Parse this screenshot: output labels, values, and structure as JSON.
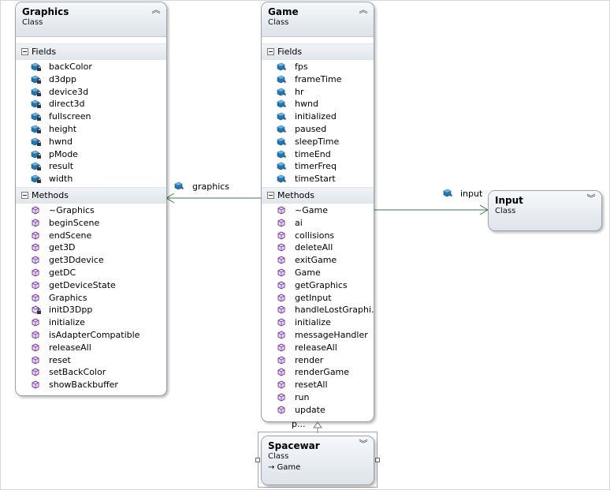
{
  "classes": {
    "graphics": {
      "name": "Graphics",
      "stereotype": "Class",
      "toggle": "︽",
      "fields_label": "Fields",
      "fields": [
        {
          "name": "backColor",
          "icon": "private-field-icon"
        },
        {
          "name": "d3dpp",
          "icon": "private-field-icon"
        },
        {
          "name": "device3d",
          "icon": "private-field-icon"
        },
        {
          "name": "direct3d",
          "icon": "private-field-icon"
        },
        {
          "name": "fullscreen",
          "icon": "private-field-icon"
        },
        {
          "name": "height",
          "icon": "private-field-icon"
        },
        {
          "name": "hwnd",
          "icon": "private-field-icon"
        },
        {
          "name": "pMode",
          "icon": "private-field-icon"
        },
        {
          "name": "result",
          "icon": "private-field-icon"
        },
        {
          "name": "width",
          "icon": "private-field-icon"
        }
      ],
      "methods_label": "Methods",
      "methods": [
        {
          "name": "~Graphics",
          "icon": "method-icon"
        },
        {
          "name": "beginScene",
          "icon": "method-icon"
        },
        {
          "name": "endScene",
          "icon": "method-icon"
        },
        {
          "name": "get3D",
          "icon": "method-icon"
        },
        {
          "name": "get3Ddevice",
          "icon": "method-icon"
        },
        {
          "name": "getDC",
          "icon": "method-icon"
        },
        {
          "name": "getDeviceState",
          "icon": "method-icon"
        },
        {
          "name": "Graphics",
          "icon": "method-icon"
        },
        {
          "name": "initD3Dpp",
          "icon": "private-method-icon"
        },
        {
          "name": "initialize",
          "icon": "method-icon"
        },
        {
          "name": "isAdapterCompatible",
          "icon": "method-icon"
        },
        {
          "name": "releaseAll",
          "icon": "method-icon"
        },
        {
          "name": "reset",
          "icon": "method-icon"
        },
        {
          "name": "setBackColor",
          "icon": "method-icon"
        },
        {
          "name": "showBackbuffer",
          "icon": "method-icon"
        }
      ]
    },
    "game": {
      "name": "Game",
      "stereotype": "Class",
      "toggle": "︽",
      "fields_label": "Fields",
      "fields": [
        {
          "name": "fps",
          "icon": "protected-field-icon"
        },
        {
          "name": "frameTime",
          "icon": "protected-field-icon"
        },
        {
          "name": "hr",
          "icon": "protected-field-icon"
        },
        {
          "name": "hwnd",
          "icon": "protected-field-icon"
        },
        {
          "name": "initialized",
          "icon": "protected-field-icon"
        },
        {
          "name": "paused",
          "icon": "protected-field-icon"
        },
        {
          "name": "sleepTime",
          "icon": "protected-field-icon"
        },
        {
          "name": "timeEnd",
          "icon": "protected-field-icon"
        },
        {
          "name": "timerFreq",
          "icon": "protected-field-icon"
        },
        {
          "name": "timeStart",
          "icon": "protected-field-icon"
        }
      ],
      "methods_label": "Methods",
      "methods": [
        {
          "name": "~Game",
          "icon": "method-icon"
        },
        {
          "name": "ai",
          "icon": "method-icon"
        },
        {
          "name": "collisions",
          "icon": "method-icon"
        },
        {
          "name": "deleteAll",
          "icon": "method-icon"
        },
        {
          "name": "exitGame",
          "icon": "method-icon"
        },
        {
          "name": "Game",
          "icon": "method-icon"
        },
        {
          "name": "getGraphics",
          "icon": "method-icon"
        },
        {
          "name": "getInput",
          "icon": "method-icon"
        },
        {
          "name": "handleLostGraphi...",
          "icon": "method-icon"
        },
        {
          "name": "initialize",
          "icon": "method-icon"
        },
        {
          "name": "messageHandler",
          "icon": "method-icon"
        },
        {
          "name": "releaseAll",
          "icon": "method-icon"
        },
        {
          "name": "render",
          "icon": "method-icon"
        },
        {
          "name": "renderGame",
          "icon": "method-icon"
        },
        {
          "name": "resetAll",
          "icon": "method-icon"
        },
        {
          "name": "run",
          "icon": "method-icon"
        },
        {
          "name": "update",
          "icon": "method-icon"
        }
      ]
    },
    "input": {
      "name": "Input",
      "stereotype": "Class",
      "toggle": "︾"
    },
    "spacewar": {
      "name": "Spacewar",
      "stereotype": "Class",
      "toggle": "︾",
      "inherits": "→ Game"
    }
  },
  "associations": {
    "graphics": {
      "label": "graphics",
      "icon": "protected-field-icon"
    },
    "input": {
      "label": "input",
      "icon": "protected-field-icon"
    }
  },
  "inheritance_label": "p...",
  "colors": {
    "connector": "#3a7d44",
    "field_icon": "#1f78b4",
    "method_icon": "#7b3fa0"
  }
}
